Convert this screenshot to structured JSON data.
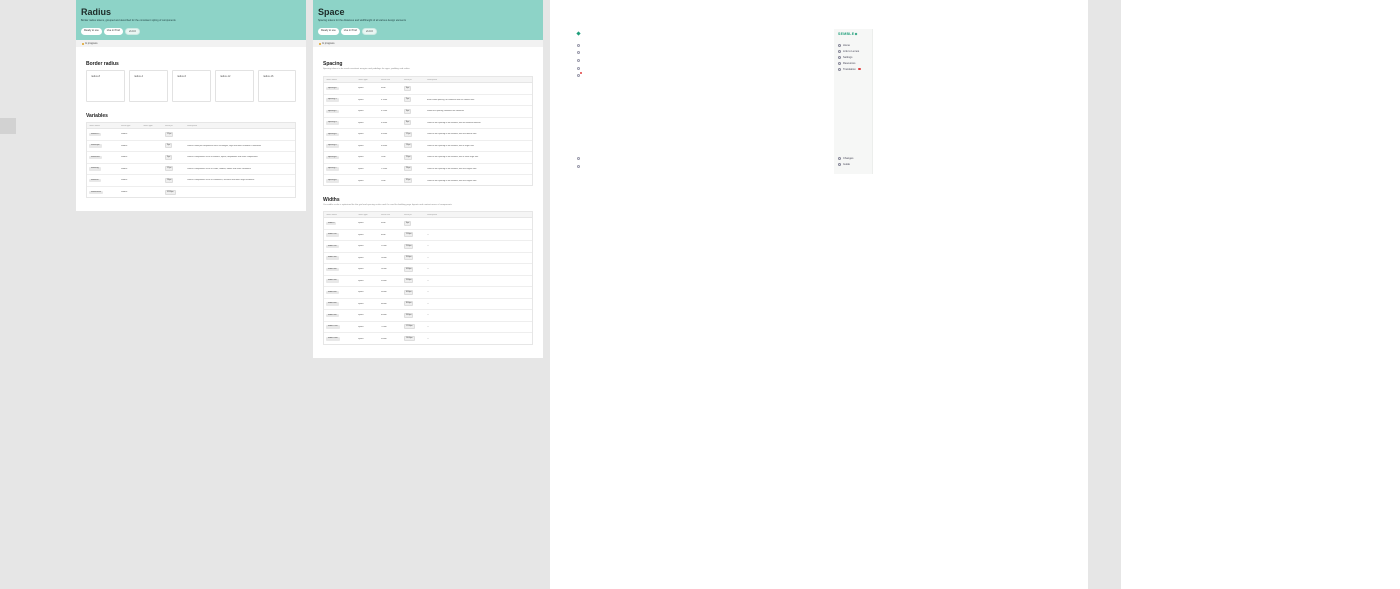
{
  "radius_page": {
    "title": "Radius",
    "description": "Border radius tokens, grouped and described for the consistent styling of components",
    "pills": [
      "Ready to use",
      "Live in Prod",
      "v1.0.0"
    ],
    "status": "In progress",
    "border_radius_title": "Border radius",
    "cards": [
      "radius-8",
      "radius-4",
      "radius-6",
      "radius-12",
      "radius-16"
    ],
    "variables_title": "Variables",
    "table_headers": [
      "Token name",
      "Value type",
      "Token type",
      "Value px",
      "Description"
    ],
    "rows": [
      {
        "name": "radius-12",
        "type": "Radius",
        "px": "12px",
        "desc": ""
      },
      {
        "name": "radius-pill",
        "type": "Radius",
        "px": "9px",
        "desc": "Used in small pill components such as badges, tags and other rounded UI elements"
      },
      {
        "name": "radius-full",
        "type": "Radius",
        "px": "9px",
        "desc": "Used in components such as buttons, inputs, dropdowns and other components"
      },
      {
        "name": "radius-lg",
        "type": "Radius",
        "px": "12px",
        "desc": "Used in components such as cards, modals, tables and other containers"
      },
      {
        "name": "radius-xl",
        "type": "Radius",
        "px": "16px",
        "desc": "Used in components such as containers, sections and other larger elements"
      },
      {
        "name": "radius-max",
        "type": "Radius",
        "px": "9999px",
        "desc": ""
      }
    ]
  },
  "space_page": {
    "title": "Space",
    "description": "Spacing tokens for the distances and widthheight of all various design elements",
    "pills": [
      "Ready to use",
      "Live in Prod",
      "v1.0.0"
    ],
    "status": "In progress",
    "spacing_title": "Spacing",
    "spacing_desc": "Spacing tokens to be used consistent margins and paddings for apps, padding and radius",
    "spacing_headers": [
      "Token name",
      "Token type",
      "Value rem",
      "Value px",
      "Description"
    ],
    "spacing_rows": [
      {
        "name": "spacing-0",
        "type": "Space",
        "rem": "0rem",
        "px": "0px",
        "desc": ""
      },
      {
        "name": "spacing-1",
        "type": "Space",
        "rem": "0.1rem",
        "px": "2px",
        "desc": "Extra small spacing, for elements with no content info"
      },
      {
        "name": "spacing-2",
        "type": "Space",
        "rem": "0.2rem",
        "px": "4px",
        "desc": "Small first spacing, between the elements"
      },
      {
        "name": "spacing-3",
        "type": "Space",
        "rem": "0.4rem",
        "px": "8px",
        "desc": "Used as the spacing of an element, with no medium element"
      },
      {
        "name": "spacing-4",
        "type": "Space",
        "rem": "0.6rem",
        "px": "12px",
        "desc": "Used as the spacing of an element, with the default size"
      },
      {
        "name": "spacing-5",
        "type": "Space",
        "rem": "0.8rem",
        "px": "16px",
        "desc": "Used as the spacing of an element, with a larger size"
      },
      {
        "name": "spacing-6",
        "type": "Space",
        "rem": "1rem",
        "px": "20px",
        "desc": "Used as the spacing of an element, with a extra large size"
      },
      {
        "name": "spacing-7",
        "type": "Space",
        "rem": "1.5rem",
        "px": "24px",
        "desc": "Used as the spacing of an element, with the largest size"
      },
      {
        "name": "spacing-8",
        "type": "Space",
        "rem": "2rem",
        "px": "32px",
        "desc": "Used as the spacing of an element, with the largest size"
      }
    ],
    "widths_title": "Widths",
    "widths_desc": "Our widths scale is optimised for the grid and spacing scales and it's used for building page layouts and content areas of components",
    "widths_headers": [
      "Token name",
      "Token type",
      "Value rem",
      "Value px",
      "Description"
    ],
    "widths_rows": [
      {
        "name": "width-0",
        "type": "Space",
        "rem": "0rem",
        "px": "0px",
        "desc": ""
      },
      {
        "name": "width-100",
        "type": "Space",
        "rem": "6rem",
        "px": "100px",
        "desc": "—"
      },
      {
        "name": "width-200",
        "type": "Space",
        "rem": "12rem",
        "px": "200px",
        "desc": "—"
      },
      {
        "name": "width-300",
        "type": "Space",
        "rem": "18rem",
        "px": "300px",
        "desc": "—"
      },
      {
        "name": "width-400",
        "type": "Space",
        "rem": "24rem",
        "px": "400px",
        "desc": "—"
      },
      {
        "name": "width-500",
        "type": "Space",
        "rem": "30rem",
        "px": "500px",
        "desc": "—"
      },
      {
        "name": "width-600",
        "type": "Space",
        "rem": "36rem",
        "px": "600px",
        "desc": "—"
      },
      {
        "name": "width-800",
        "type": "Space",
        "rem": "48rem",
        "px": "800px",
        "desc": "—"
      },
      {
        "name": "width-960",
        "type": "Space",
        "rem": "60rem",
        "px": "960px",
        "desc": "—"
      },
      {
        "name": "width-1200",
        "type": "Space",
        "rem": "72rem",
        "px": "1200px",
        "desc": "—"
      },
      {
        "name": "width-1440",
        "type": "Space",
        "rem": "90rem",
        "px": "1440px",
        "desc": "—"
      }
    ]
  },
  "sidebar": {
    "logo": "SEMBLE",
    "items": [
      "Home",
      "Link to Lumos",
      "Settings",
      "Resources",
      "Translation"
    ],
    "bottom_items": [
      "Changes",
      "Guide"
    ]
  },
  "colors": {
    "header_teal": "#8dd3c7",
    "accent_green": "#1e9e7a",
    "badge_red": "#e04040"
  }
}
